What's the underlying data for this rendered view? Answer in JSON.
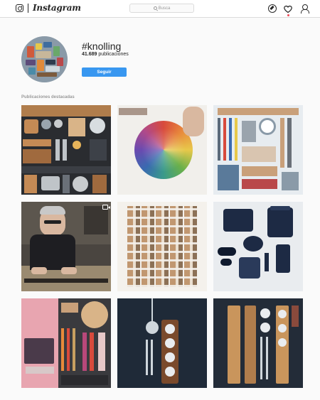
{
  "header": {
    "wordmark": "Instagram",
    "search_placeholder": "Busca"
  },
  "profile": {
    "hashtag": "#knolling",
    "post_count": "41.689",
    "post_count_suffix": "publicaciones",
    "follow_label": "Seguir"
  },
  "section": {
    "label": "Publicaciones destacadas"
  },
  "colors": {
    "accent": "#3897f0",
    "notification": "#ed4956"
  },
  "posts": [
    {
      "subject": "workshop tools grid"
    },
    {
      "subject": "watercolor swatches"
    },
    {
      "subject": "craft tools"
    },
    {
      "subject": "man at workbench"
    },
    {
      "subject": "seashells"
    },
    {
      "subject": "navy gear"
    },
    {
      "subject": "pink paper and tools"
    },
    {
      "subject": "wood tool holder"
    },
    {
      "subject": "wooden organizer"
    }
  ],
  "icons": [
    "instagram-icon",
    "search-icon",
    "compass-icon",
    "heart-icon",
    "profile-icon",
    "video-icon"
  ]
}
